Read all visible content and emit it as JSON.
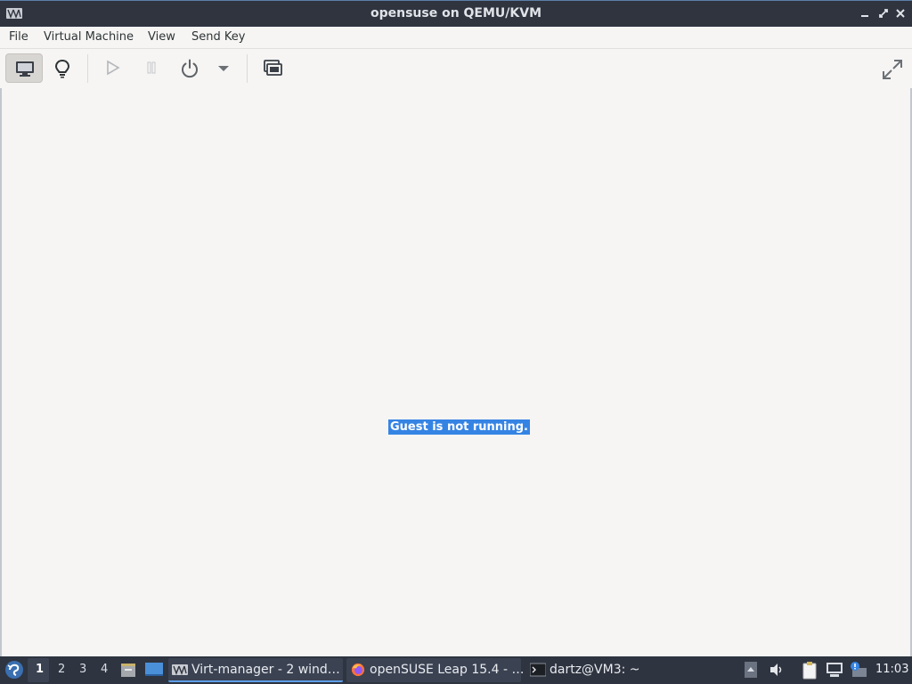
{
  "window": {
    "title": "opensuse on QEMU/KVM"
  },
  "menubar": {
    "items": [
      "File",
      "Virtual Machine",
      "View",
      "Send Key"
    ]
  },
  "toolbar": {
    "buttons": [
      {
        "name": "console-view",
        "icon": "monitor-icon",
        "active": true
      },
      {
        "name": "details-view",
        "icon": "lightbulb-icon",
        "active": false
      },
      {
        "name": "run",
        "icon": "play-icon",
        "enabled": false
      },
      {
        "name": "pause",
        "icon": "pause-icon",
        "enabled": false
      },
      {
        "name": "shutdown",
        "icon": "power-icon",
        "enabled": true
      },
      {
        "name": "shutdown-menu",
        "icon": "chevron-down-icon",
        "enabled": true
      },
      {
        "name": "snapshots",
        "icon": "snapshot-icon",
        "enabled": true
      },
      {
        "name": "fullscreen",
        "icon": "fullscreen-icon",
        "enabled": true
      }
    ]
  },
  "main": {
    "status_message": "Guest is not running."
  },
  "taskbar": {
    "workspaces": [
      "1",
      "2",
      "3",
      "4"
    ],
    "current_workspace": "1",
    "tasks": [
      {
        "label": "Virt-manager - 2 wind…",
        "icon": "virt-manager-icon",
        "active": true
      },
      {
        "label": "openSUSE Leap 15.4 - …",
        "icon": "firefox-icon",
        "active": false
      },
      {
        "label": "dartz@VM3: ~",
        "icon": "terminal-icon",
        "active": false
      }
    ],
    "clock": "11:03"
  },
  "colors": {
    "titlebar_bg": "#2f343f",
    "taskbar_bg": "#2e3440",
    "selection": "#3584e4",
    "window_bg": "#f6f5f4"
  }
}
